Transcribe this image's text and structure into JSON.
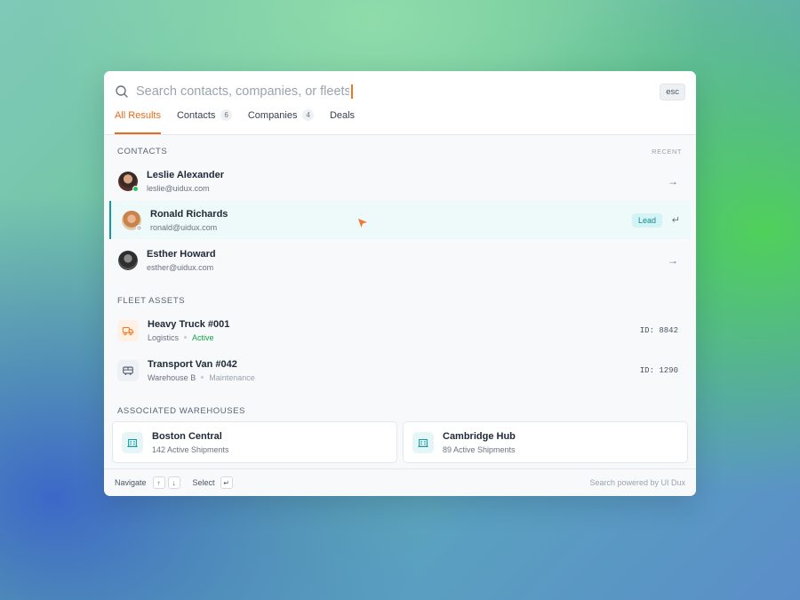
{
  "search": {
    "placeholder": "Search contacts, companies, or fleets...",
    "esc_label": "esc"
  },
  "tabs": [
    {
      "label": "All Results",
      "count": null
    },
    {
      "label": "Contacts",
      "count": "6"
    },
    {
      "label": "Companies",
      "count": "4"
    },
    {
      "label": "Deals",
      "count": null
    }
  ],
  "contacts": {
    "heading": "CONTACTS",
    "recent_label": "RECENT",
    "items": [
      {
        "name": "Leslie Alexander",
        "email": "leslie@uidux.com"
      },
      {
        "name": "Ronald Richards",
        "email": "ronald@uidux.com",
        "badge": "Lead"
      },
      {
        "name": "Esther Howard",
        "email": "esther@uidux.com"
      }
    ]
  },
  "fleet": {
    "heading": "FLEET ASSETS",
    "items": [
      {
        "name": "Heavy Truck #001",
        "group": "Logistics",
        "status": "Active",
        "id": "ID: 8842"
      },
      {
        "name": "Transport Van #042",
        "group": "Warehouse B",
        "status": "Maintenance",
        "id": "ID: 1290"
      }
    ]
  },
  "warehouses": {
    "heading": "ASSOCIATED WAREHOUSES",
    "items": [
      {
        "name": "Boston Central",
        "detail": "142 Active Shipments"
      },
      {
        "name": "Cambridge Hub",
        "detail": "89 Active Shipments"
      }
    ]
  },
  "footer": {
    "navigate_label": "Navigate",
    "select_label": "Select",
    "powered_by": "Search powered by UI Dux"
  },
  "colors": {
    "accent_orange": "#e86a1a",
    "accent_teal": "#129aa3",
    "status_online": "#22c55e",
    "status_active": "#16a34a"
  }
}
